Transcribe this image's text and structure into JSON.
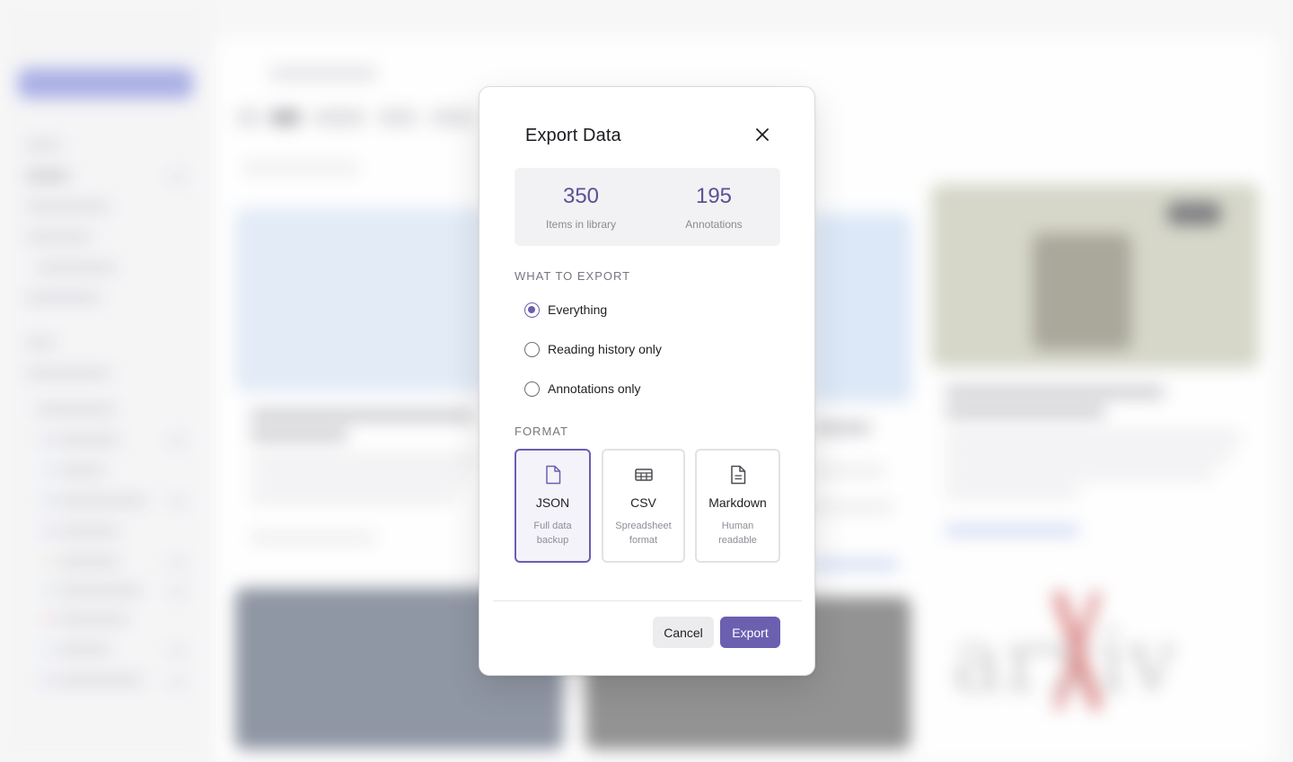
{
  "dialog": {
    "title": "Export Data",
    "close_icon": "close-icon",
    "stats": [
      {
        "value": "350",
        "label": "Items in library"
      },
      {
        "value": "195",
        "label": "Annotations"
      }
    ],
    "what_to_export": {
      "heading": "WHAT TO EXPORT",
      "options": [
        {
          "label": "Everything",
          "checked": true
        },
        {
          "label": "Reading history only",
          "checked": false
        },
        {
          "label": "Annotations only",
          "checked": false
        }
      ]
    },
    "format": {
      "heading": "FORMAT",
      "options": [
        {
          "name": "JSON",
          "desc_line1": "Full data",
          "desc_line2": "backup",
          "icon": "file-icon",
          "selected": true
        },
        {
          "name": "CSV",
          "desc_line1": "Spreadsheet",
          "desc_line2": "format",
          "icon": "table-icon",
          "selected": false
        },
        {
          "name": "Markdown",
          "desc_line1": "Human",
          "desc_line2": "readable",
          "icon": "document-icon",
          "selected": false
        }
      ]
    },
    "buttons": {
      "cancel": "Cancel",
      "export": "Export"
    }
  },
  "colors": {
    "accent": "#6b5fb0",
    "stat_value": "#5b5195",
    "background": "#f6f6f7"
  }
}
